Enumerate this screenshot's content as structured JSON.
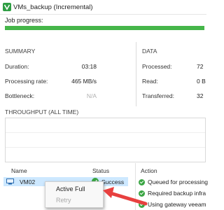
{
  "window": {
    "title": "VMs_backup (Incremental)"
  },
  "job_progress": {
    "label": "Job progress:",
    "percent": 100,
    "color": "#45b649"
  },
  "summary": {
    "heading": "SUMMARY",
    "rows": [
      {
        "label": "Duration:",
        "value": "03:18"
      },
      {
        "label": "Processing rate:",
        "value": "465 MB/s"
      },
      {
        "label": "Bottleneck:",
        "value": "N/A"
      }
    ]
  },
  "data": {
    "heading": "DATA",
    "rows": [
      {
        "label": "Processed:",
        "value": "72"
      },
      {
        "label": "Read:",
        "value": "0 B"
      },
      {
        "label": "Transferred:",
        "value": "32"
      }
    ]
  },
  "throughput": {
    "heading": "THROUGHPUT (ALL TIME)"
  },
  "vm_list": {
    "columns": {
      "name": "Name",
      "status": "Status"
    },
    "rows": [
      {
        "name": "VM02",
        "status": "Success"
      }
    ]
  },
  "actions": {
    "heading": "Action",
    "items": [
      "Queued for processing",
      "Required backup infra",
      "Using gateway veeam"
    ]
  },
  "context_menu": {
    "items": [
      {
        "label": "Active Full",
        "enabled": true
      },
      {
        "label": "Retry",
        "enabled": false
      }
    ]
  },
  "colors": {
    "accent_green": "#45b649",
    "selection": "#cde8ff",
    "arrow": "#e8403f"
  }
}
